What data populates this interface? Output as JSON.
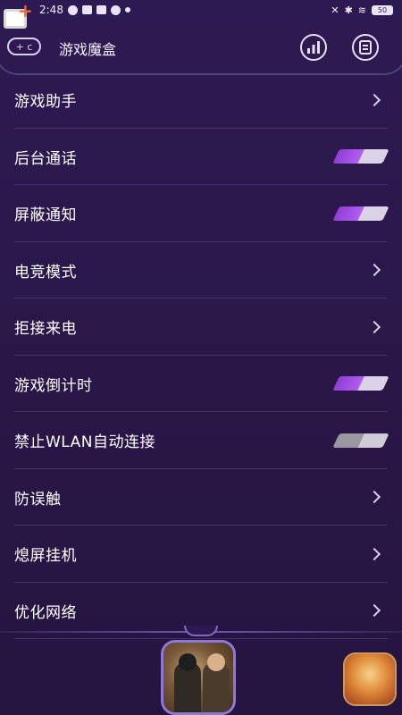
{
  "status_bar": {
    "time": "2:48",
    "battery": "50"
  },
  "header": {
    "title": "游戏魔盒",
    "gamepad_label": "+ c"
  },
  "settings": [
    {
      "label": "游戏助手",
      "control": "chevron"
    },
    {
      "label": "后台通话",
      "control": "toggle",
      "on": true
    },
    {
      "label": "屏蔽通知",
      "control": "toggle",
      "on": true
    },
    {
      "label": "电竞模式",
      "control": "chevron"
    },
    {
      "label": "拒接来电",
      "control": "chevron"
    },
    {
      "label": "游戏倒计时",
      "control": "toggle",
      "on": true
    },
    {
      "label": "禁止WLAN自动连接",
      "control": "toggle",
      "on": false
    },
    {
      "label": "防误触",
      "control": "chevron"
    },
    {
      "label": "熄屏挂机",
      "control": "chevron"
    },
    {
      "label": "优化网络",
      "control": "chevron"
    }
  ],
  "colors": {
    "background": "#2e1a52",
    "toggle_on": "#a04fe6",
    "toggle_off": "#9a97a3",
    "accent_orange": "#f06a2a"
  },
  "dock": {
    "games": [
      {
        "icon": "pubg-game-icon"
      },
      {
        "icon": "hero-game-icon"
      }
    ]
  }
}
